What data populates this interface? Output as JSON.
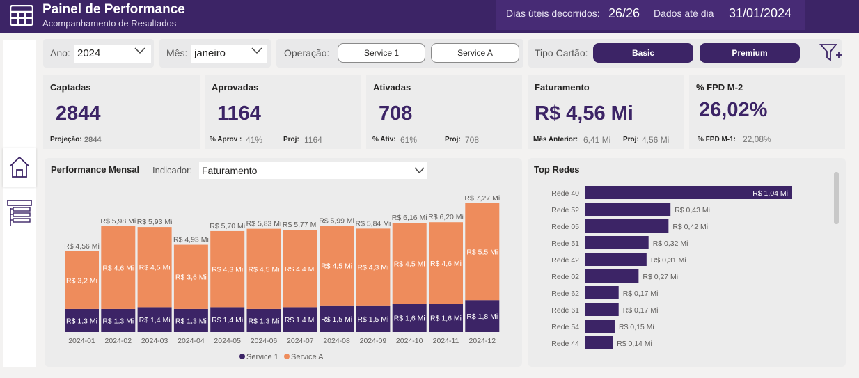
{
  "header": {
    "title": "Painel de Performance",
    "subtitle": "Acompanhamento de Resultados",
    "dias_label": "Dias úteis decorridos:",
    "dias_value": "26/26",
    "dados_label": "Dados até dia",
    "dados_value": "31/01/2024",
    "icon": "table-grid-icon"
  },
  "nav": {
    "home_icon": "home-icon",
    "list_icon": "list-icon"
  },
  "filters": {
    "ano_label": "Ano:",
    "ano_value": "2024",
    "mes_label": "Mês:",
    "mes_value": "janeiro",
    "operacao_label": "Operação:",
    "operacao_options": [
      "Service 1",
      "Service A"
    ],
    "tipo_label": "Tipo Cartão:",
    "tipo_options": [
      "Basic",
      "Premium"
    ],
    "filter_icon": "filter-add-icon"
  },
  "kpis": {
    "captadas": {
      "title": "Captadas",
      "value": "2844",
      "proj_label": "Projeção:",
      "proj_value": "2844"
    },
    "aprovadas": {
      "title": "Aprovadas",
      "value": "1164",
      "rate_label": "% Aprov :",
      "rate_value": "41%",
      "proj_label": "Proj:",
      "proj_value": "1164"
    },
    "ativadas": {
      "title": "Ativadas",
      "value": "708",
      "rate_label": "% Ativ:",
      "rate_value": "61%",
      "proj_label": "Proj:",
      "proj_value": "708"
    },
    "faturamento": {
      "title": "Faturamento",
      "value": "R$ 4,56 Mi",
      "prev_label": "Mês Anterior:",
      "prev_value": "6,41 Mi",
      "proj_label": "Proj:",
      "proj_value": "4,56 Mi"
    },
    "fpd": {
      "title": "% FPD M-2",
      "value": "26,02%",
      "prev_label": "% FPD M-1:",
      "prev_value": "22,08%"
    }
  },
  "performance": {
    "title": "Performance Mensal",
    "indicator_label": "Indicador:",
    "indicator_value": "Faturamento"
  },
  "top_redes_title": "Top Redes",
  "colors": {
    "primary": "#3c2466",
    "service_a": "#ee8c5c",
    "panel": "#ececec"
  },
  "chart_data": [
    {
      "type": "bar",
      "stacked": true,
      "categories": [
        "2024-01",
        "2024-02",
        "2024-03",
        "2024-04",
        "2024-05",
        "2024-06",
        "2024-07",
        "2024-08",
        "2024-09",
        "2024-10",
        "2024-11",
        "2024-12"
      ],
      "series": [
        {
          "name": "Service 1",
          "values": [
            1.3,
            1.3,
            1.4,
            1.3,
            1.4,
            1.3,
            1.4,
            1.5,
            1.5,
            1.6,
            1.6,
            1.8
          ],
          "labels": [
            "R$ 1,3 Mi",
            "R$ 1,3 Mi",
            "R$ 1,4 Mi",
            "R$ 1,3 Mi",
            "R$ 1,4 Mi",
            "R$ 1,3 Mi",
            "R$ 1,4 Mi",
            "R$ 1,5 Mi",
            "R$ 1,5 Mi",
            "R$ 1,6 Mi",
            "R$ 1,6 Mi",
            "R$ 1,8 Mi"
          ]
        },
        {
          "name": "Service A",
          "values": [
            3.2,
            4.6,
            4.5,
            3.6,
            4.3,
            4.5,
            4.4,
            4.5,
            4.3,
            4.5,
            4.6,
            5.5
          ],
          "labels": [
            "R$ 3,2 Mi",
            "R$ 4,6 Mi",
            "R$ 4,5 Mi",
            "R$ 3,6 Mi",
            "R$ 4,3 Mi",
            "R$ 4,5 Mi",
            "R$ 4,4 Mi",
            "R$ 4,5 Mi",
            "R$ 4,3 Mi",
            "R$ 4,5 Mi",
            "R$ 4,6 Mi",
            "R$ 5,5 Mi"
          ]
        }
      ],
      "totals": [
        4.56,
        5.98,
        5.93,
        4.93,
        5.7,
        5.83,
        5.77,
        5.99,
        5.84,
        6.16,
        6.2,
        7.27
      ],
      "total_labels": [
        "R$ 4,56 Mi",
        "R$ 5,98 Mi",
        "R$ 5,93 Mi",
        "R$ 4,93 Mi",
        "R$ 5,70 Mi",
        "R$ 5,83 Mi",
        "R$ 5,77 Mi",
        "R$ 5,99 Mi",
        "R$ 5,84 Mi",
        "R$ 6,16 Mi",
        "R$ 6,20 Mi",
        "R$ 7,27 Mi"
      ],
      "ylim": [
        0,
        7.27
      ],
      "legend": "bottom"
    },
    {
      "type": "bar",
      "orientation": "horizontal",
      "categories": [
        "Rede 40",
        "Rede 52",
        "Rede 05",
        "Rede 51",
        "Rede 42",
        "Rede 02",
        "Rede 62",
        "Rede 61",
        "Rede 54",
        "Rede 44"
      ],
      "values": [
        1.04,
        0.43,
        0.42,
        0.32,
        0.31,
        0.27,
        0.17,
        0.17,
        0.15,
        0.14
      ],
      "labels": [
        "R$ 1,04 Mi",
        "R$ 0,43 Mi",
        "R$ 0,42 Mi",
        "R$ 0,32 Mi",
        "R$ 0,31 Mi",
        "R$ 0,27 Mi",
        "R$ 0,17 Mi",
        "R$ 0,17 Mi",
        "R$ 0,15 Mi",
        "R$ 0,14 Mi"
      ],
      "xlim": [
        0,
        1.04
      ]
    }
  ]
}
